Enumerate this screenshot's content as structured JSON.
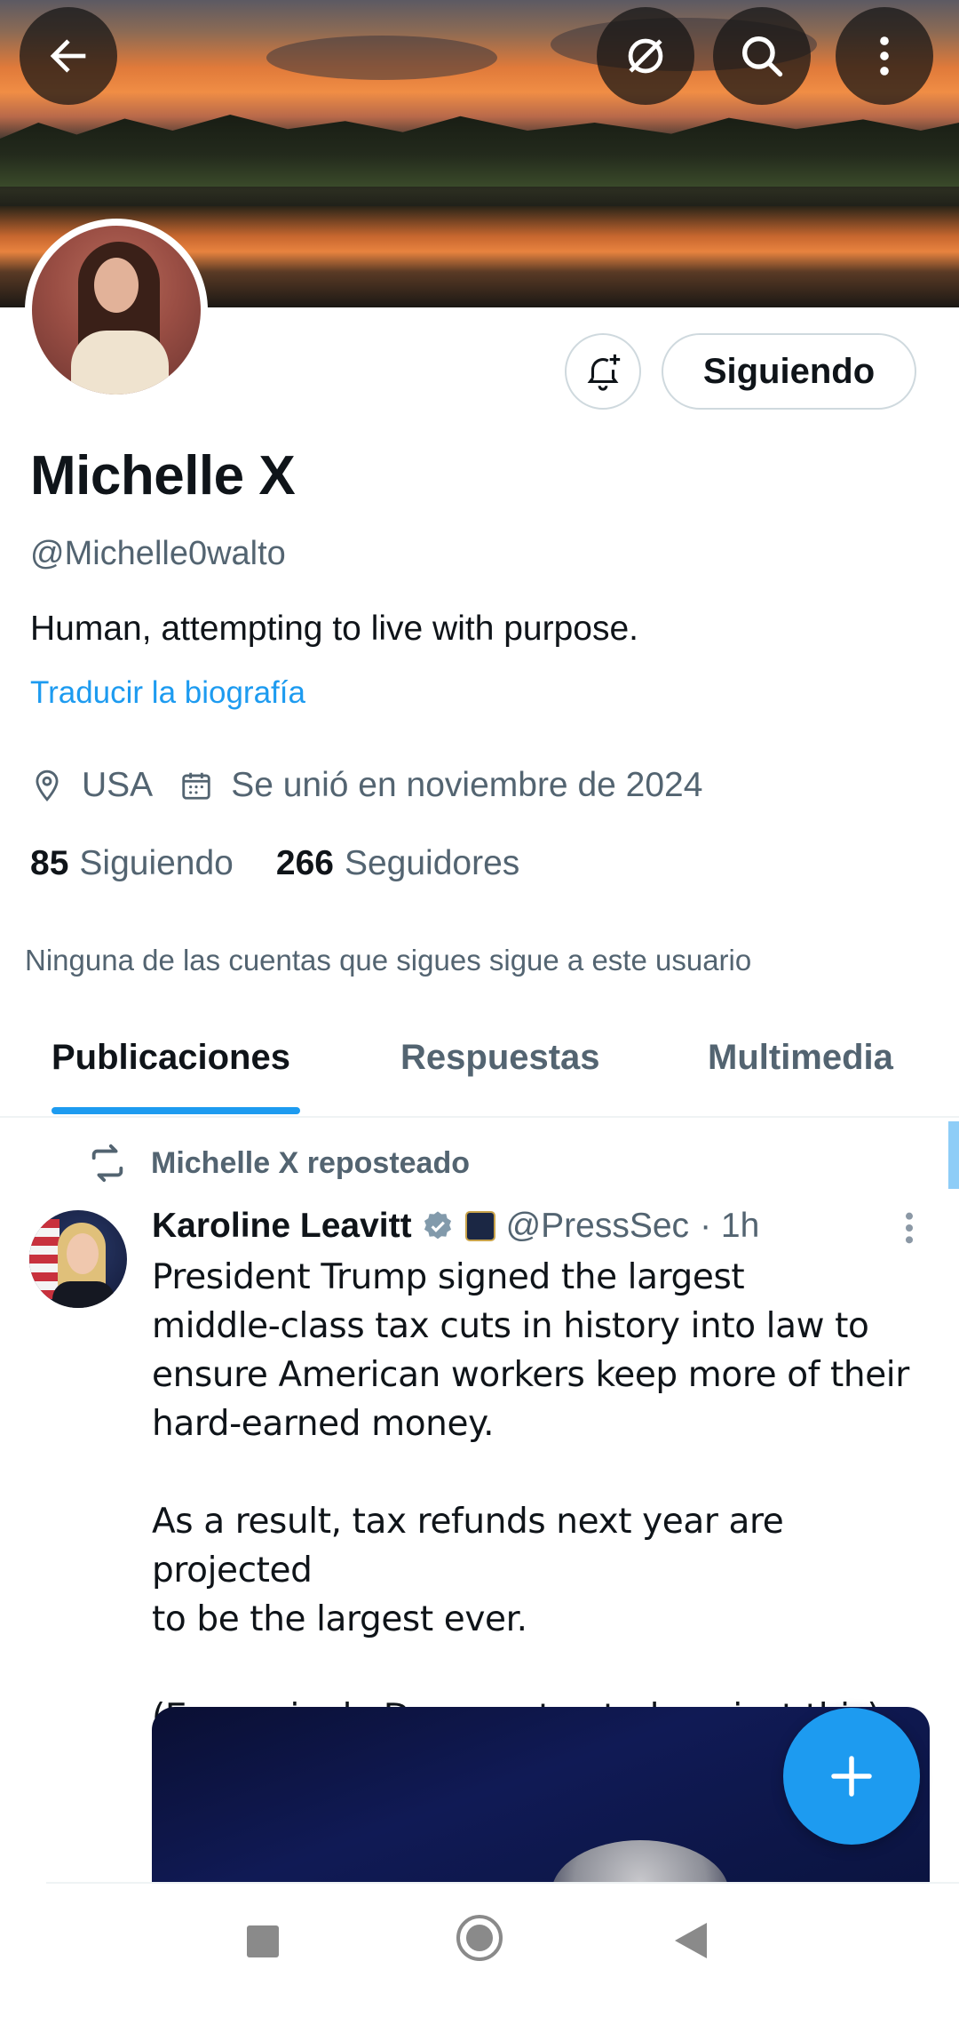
{
  "header": {
    "back_icon": "arrow-left-icon",
    "grok_icon": "grok-icon",
    "search_icon": "search-icon",
    "more_icon": "more-vertical-icon"
  },
  "profile": {
    "name": "Michelle X",
    "handle": "@Michelle0walto",
    "bio": "Human, attempting to live with purpose.",
    "translate_label": "Traducir la biografía",
    "location": "USA",
    "joined": "Se unió en noviembre de 2024",
    "following_count": "85",
    "following_label": "Siguiendo",
    "followers_count": "266",
    "followers_label": "Seguidores",
    "mutuals_note": "Ninguna de las cuentas que sigues sigue a este usuario",
    "follow_button_label": "Siguiendo"
  },
  "tabs": [
    {
      "label": "Publicaciones",
      "active": true
    },
    {
      "label": "Respuestas",
      "active": false
    },
    {
      "label": "Multimedia",
      "active": false
    }
  ],
  "post": {
    "repost_label": "Michelle X reposteado",
    "author_name": "Karoline Leavitt",
    "author_handle": "@PressSec",
    "time": "· 1h",
    "text": "President Trump signed the largest\nmiddle-class tax cuts in history into law to\nensure American workers keep more of their\nhard-earned money.\n\nAs a result, tax refunds next year are projected\nto be the largest ever.\n\n(Every single Democrat voted against this)"
  },
  "colors": {
    "accent": "#1d9bf0",
    "text_primary": "#0f1419",
    "text_secondary": "#536471",
    "border": "#cfd9de"
  }
}
